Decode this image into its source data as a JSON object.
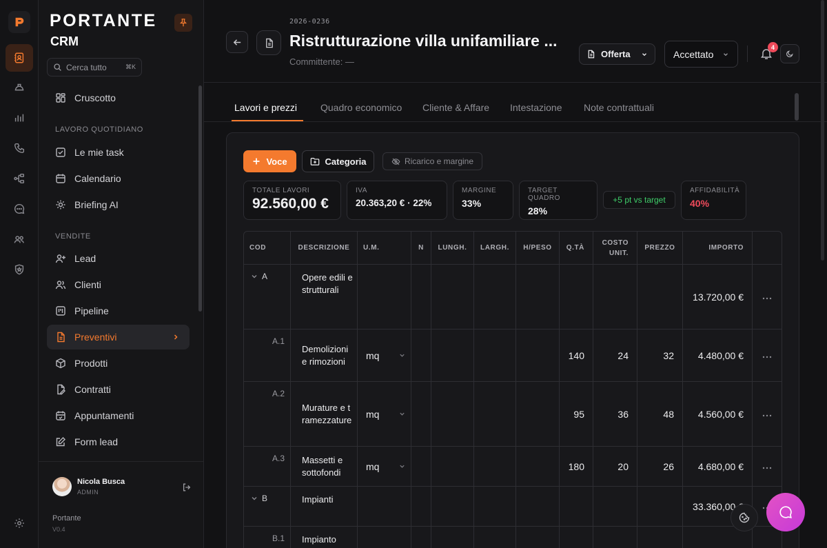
{
  "brand": {
    "name": "PORTANTE",
    "product": "CRM",
    "version_name": "Portante",
    "version": "V0.4"
  },
  "search": {
    "placeholder": "Cerca tutto",
    "shortcut": "⌘K"
  },
  "sidebar": {
    "top_item": "Cruscotto",
    "sections": [
      {
        "title": "LAVORO QUOTIDIANO",
        "items": [
          "Le mie task",
          "Calendario",
          "Briefing AI"
        ]
      },
      {
        "title": "VENDITE",
        "items": [
          "Lead",
          "Clienti",
          "Pipeline",
          "Preventivi",
          "Prodotti",
          "Contratti",
          "Appuntamenti",
          "Form lead"
        ]
      }
    ],
    "active_item": "Preventivi"
  },
  "user": {
    "name": "Nicola Busca",
    "role": "ADMIN"
  },
  "header": {
    "code": "2026-0236",
    "title": "Ristrutturazione villa unifamiliare ...",
    "client": "Committente: —",
    "doc_type": "Offerta",
    "status": "Accettato",
    "notifications": "4"
  },
  "tabs": [
    "Lavori e prezzi",
    "Quadro economico",
    "Cliente & Affare",
    "Intestazione",
    "Note contrattuali"
  ],
  "toolbar": {
    "voce": "Voce",
    "categoria": "Categoria",
    "ricarico": "Ricarico e margine"
  },
  "stats": {
    "totale_label": "TOTALE LAVORI",
    "totale": "92.560,00 €",
    "iva_label": "IVA",
    "iva": "20.363,20 € · 22%",
    "margine_label": "MARGINE",
    "margine": "33%",
    "target_label": "TARGET QUADRO",
    "target": "28%",
    "vs_target": "+5 pt vs target",
    "affidabilita_label": "AFFIDABILITÀ",
    "affidabilita": "40%"
  },
  "table": {
    "headers": [
      "COD",
      "DESCRIZIONE",
      "U.M.",
      "N",
      "LUNGH.",
      "LARGH.",
      "H/PESO",
      "Q.TÀ",
      "COSTO UNIT.",
      "PREZZO",
      "IMPORTO"
    ],
    "rows": [
      {
        "cod": "A",
        "kind": "category",
        "desc": "Opere edili e strutturali",
        "um": "",
        "qta": "",
        "costo": "",
        "prezzo": "",
        "importo": "13.720,00 €"
      },
      {
        "cod": "A.1",
        "kind": "item",
        "desc": "Demolizioni e rimozioni",
        "um": "mq",
        "qta": "140",
        "costo": "24",
        "prezzo": "32",
        "importo": "4.480,00 €"
      },
      {
        "cod": "A.2",
        "kind": "item",
        "desc": "Murature e tramezzature",
        "um": "mq",
        "qta": "95",
        "costo": "36",
        "prezzo": "48",
        "importo": "4.560,00 €"
      },
      {
        "cod": "A.3",
        "kind": "item",
        "desc": "Massetti e sottofondi",
        "um": "mq",
        "qta": "180",
        "costo": "20",
        "prezzo": "26",
        "importo": "4.680,00 €"
      },
      {
        "cod": "B",
        "kind": "category",
        "desc": "Impianti",
        "um": "",
        "qta": "",
        "costo": "",
        "prezzo": "",
        "importo": "33.360,00 €"
      },
      {
        "cod": "B.1",
        "kind": "item",
        "desc": "Impianto",
        "um": "",
        "qta": "",
        "costo": "",
        "prezzo": "",
        "importo": ""
      }
    ]
  },
  "colors": {
    "accent": "#f47a2e",
    "danger": "#ef4a5a",
    "success": "#3fcf6a",
    "chat": "#d846cf"
  }
}
